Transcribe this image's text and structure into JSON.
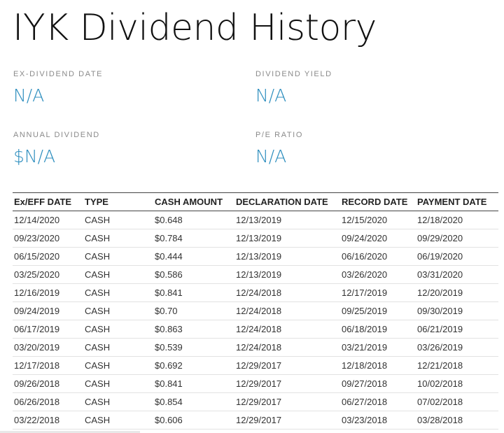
{
  "page": {
    "title": "IYK Dividend History"
  },
  "stats": {
    "ex_dividend_date": {
      "label": "EX-DIVIDEND DATE",
      "value": "N/A"
    },
    "dividend_yield": {
      "label": "DIVIDEND YIELD",
      "value": "N/A"
    },
    "annual_dividend": {
      "label": "ANNUAL DIVIDEND",
      "value": "$N/A"
    },
    "pe_ratio": {
      "label": "P/E RATIO",
      "value": "N/A"
    }
  },
  "colors": {
    "value_accent": "#2f8fbf",
    "label_gray": "#8a8a8a"
  },
  "table": {
    "headers": [
      "Ex/EFF DATE",
      "TYPE",
      "CASH AMOUNT",
      "DECLARATION DATE",
      "RECORD DATE",
      "PAYMENT DATE"
    ],
    "rows": [
      [
        "12/14/2020",
        "CASH",
        "$0.648",
        "12/13/2019",
        "12/15/2020",
        "12/18/2020"
      ],
      [
        "09/23/2020",
        "CASH",
        "$0.784",
        "12/13/2019",
        "09/24/2020",
        "09/29/2020"
      ],
      [
        "06/15/2020",
        "CASH",
        "$0.444",
        "12/13/2019",
        "06/16/2020",
        "06/19/2020"
      ],
      [
        "03/25/2020",
        "CASH",
        "$0.586",
        "12/13/2019",
        "03/26/2020",
        "03/31/2020"
      ],
      [
        "12/16/2019",
        "CASH",
        "$0.841",
        "12/24/2018",
        "12/17/2019",
        "12/20/2019"
      ],
      [
        "09/24/2019",
        "CASH",
        "$0.70",
        "12/24/2018",
        "09/25/2019",
        "09/30/2019"
      ],
      [
        "06/17/2019",
        "CASH",
        "$0.863",
        "12/24/2018",
        "06/18/2019",
        "06/21/2019"
      ],
      [
        "03/20/2019",
        "CASH",
        "$0.539",
        "12/24/2018",
        "03/21/2019",
        "03/26/2019"
      ],
      [
        "12/17/2018",
        "CASH",
        "$0.692",
        "12/29/2017",
        "12/18/2018",
        "12/21/2018"
      ],
      [
        "09/26/2018",
        "CASH",
        "$0.841",
        "12/29/2017",
        "09/27/2018",
        "10/02/2018"
      ],
      [
        "06/26/2018",
        "CASH",
        "$0.854",
        "12/29/2017",
        "06/27/2018",
        "07/02/2018"
      ],
      [
        "03/22/2018",
        "CASH",
        "$0.606",
        "12/29/2017",
        "03/23/2018",
        "03/28/2018"
      ]
    ]
  }
}
